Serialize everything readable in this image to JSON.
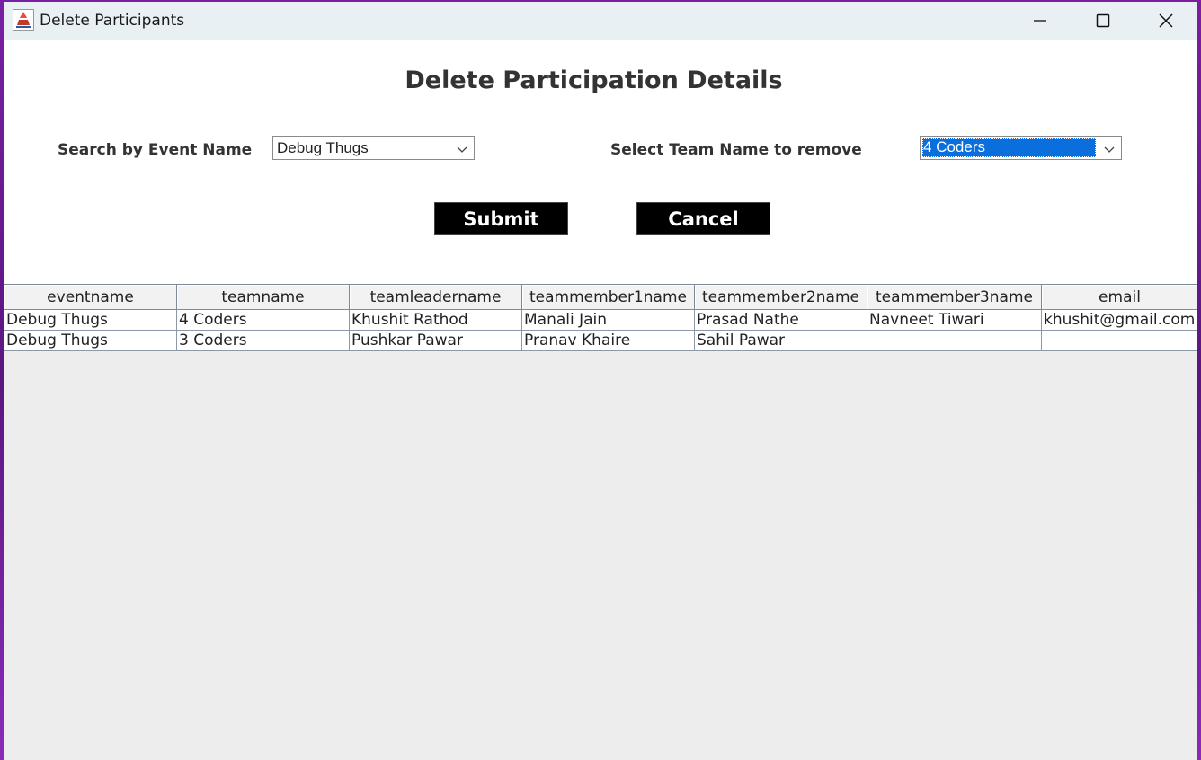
{
  "window": {
    "title": "Delete Participants"
  },
  "page": {
    "heading": "Delete Participation Details"
  },
  "form": {
    "event_label": "Search by Event Name",
    "event_selected": "Debug Thugs",
    "team_label": "Select Team Name to remove",
    "team_selected": "4 Coders",
    "submit_label": "Submit",
    "cancel_label": "Cancel"
  },
  "table": {
    "columns": [
      "eventname",
      "teamname",
      "teamleadername",
      "teammember1name",
      "teammember2name",
      "teammember3name",
      "email"
    ],
    "rows": [
      [
        "Debug Thugs",
        "4 Coders",
        "Khushit Rathod",
        "Manali Jain",
        "Prasad Nathe",
        "Navneet Tiwari",
        "khushit@gmail.com"
      ],
      [
        "Debug Thugs",
        "3 Coders",
        "Pushkar Pawar",
        "Pranav Khaire",
        "Sahil Pawar",
        "",
        ""
      ]
    ]
  },
  "colors": {
    "button_bg": "#000000",
    "selection_bg": "#0a6fdc",
    "titlebar_bg": "#e9f0f4",
    "table_area_bg": "#ededed"
  },
  "icons": {
    "app": "java-coffee-cup-icon",
    "minimize": "minimize-icon",
    "maximize": "maximize-icon",
    "close": "close-icon",
    "dropdown": "chevron-down-icon"
  }
}
